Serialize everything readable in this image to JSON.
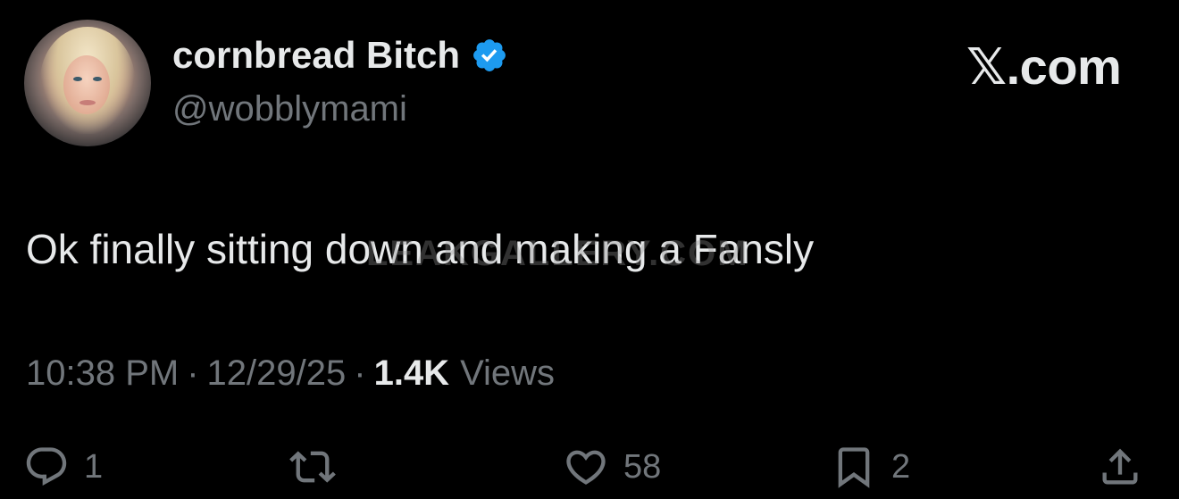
{
  "author": {
    "display_name": "cornbread Bitch",
    "handle": "@wobblymami",
    "verified_icon": "verified-badge-icon",
    "avatar_icon": "profile-photo"
  },
  "brand": {
    "label": "𝕏.com"
  },
  "tweet": {
    "text": "Ok finally sitting down and making a Fansly",
    "watermark": "LEAKGALLERY.COM"
  },
  "meta": {
    "time": "10:38 PM",
    "separator": "·",
    "date": "12/29/25",
    "views_count": "1.4K",
    "views_label": "Views"
  },
  "actions": {
    "reply": {
      "icon": "reply-icon",
      "count": "1"
    },
    "retweet": {
      "icon": "retweet-icon",
      "count": ""
    },
    "like": {
      "icon": "heart-icon",
      "count": "58"
    },
    "bookmark": {
      "icon": "bookmark-icon",
      "count": "2"
    },
    "share": {
      "icon": "share-icon",
      "count": ""
    }
  },
  "colors": {
    "background": "#000000",
    "primary_text": "#e7e9ea",
    "secondary_text": "#71767b",
    "verified_blue": "#1d9bf0"
  }
}
